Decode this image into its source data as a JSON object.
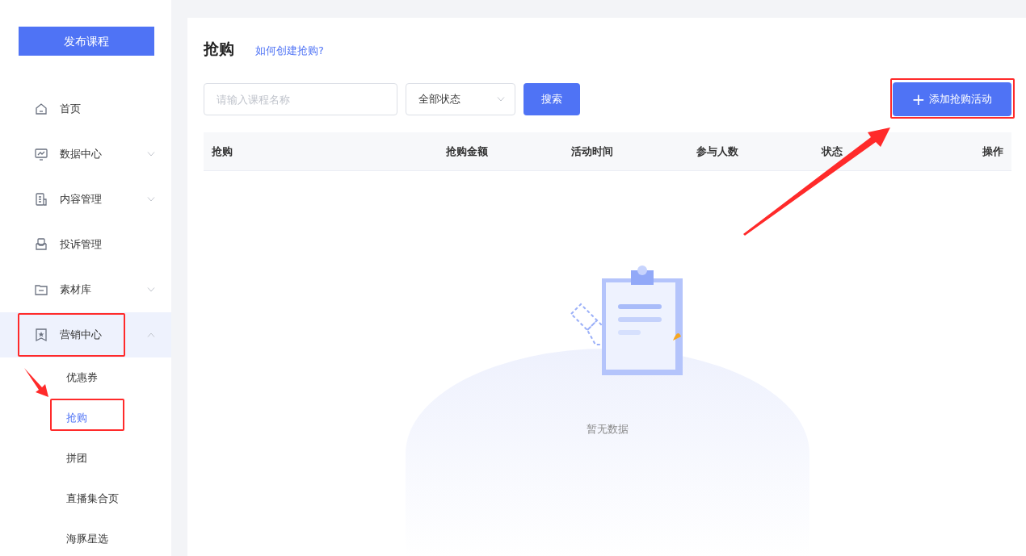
{
  "sidebar": {
    "publish_button": "发布课程",
    "items": [
      {
        "label": "首页"
      },
      {
        "label": "数据中心",
        "expanded": false
      },
      {
        "label": "内容管理",
        "expanded": false
      },
      {
        "label": "投诉管理"
      },
      {
        "label": "素材库",
        "expanded": false
      },
      {
        "label": "营销中心",
        "expanded": true,
        "children": [
          {
            "label": "优惠券",
            "selected": false
          },
          {
            "label": "抢购",
            "selected": true
          },
          {
            "label": "拼团",
            "selected": false
          },
          {
            "label": "直播集合页",
            "selected": false
          },
          {
            "label": "海豚星选",
            "selected": false
          }
        ]
      }
    ]
  },
  "main": {
    "title": "抢购",
    "help_link": "如何创建抢购?",
    "search": {
      "placeholder": "请输入课程名称"
    },
    "status_select": "全部状态",
    "search_button": "搜索",
    "add_button": {
      "icon": "+",
      "label": "添加抢购活动"
    },
    "table": {
      "columns": [
        "抢购",
        "抢购金额",
        "活动时间",
        "参与人数",
        "状态",
        "操作"
      ],
      "empty_text": "暂无数据"
    }
  }
}
